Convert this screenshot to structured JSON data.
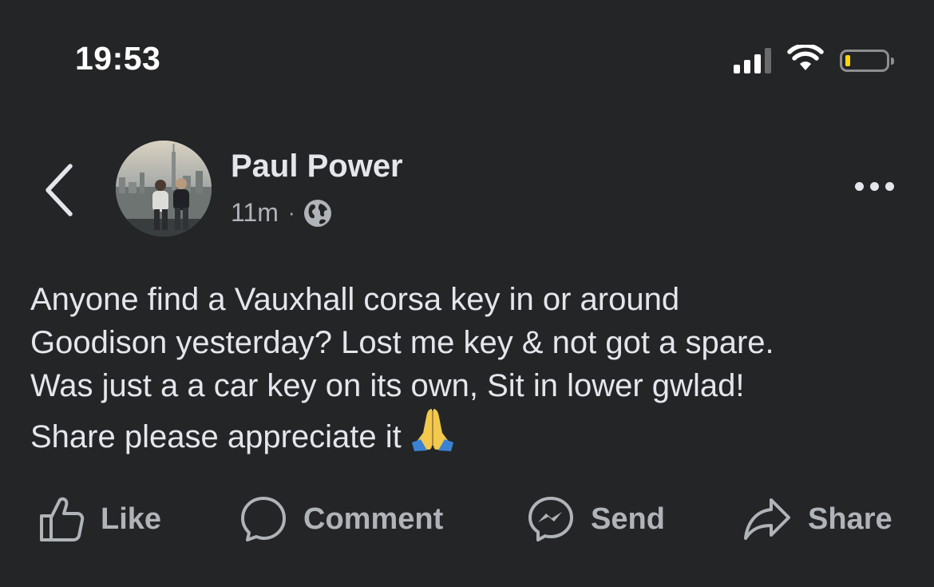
{
  "status_bar": {
    "time": "19:53"
  },
  "post": {
    "author": "Paul Power",
    "time_ago": "11m",
    "separator": "·",
    "text": "Anyone find a Vauxhall corsa key in or around\nGoodison yesterday? Lost me key & not got a spare.\nWas just a a car key on its own, Sit in lower gwlad!\nShare please appreciate it",
    "emoji": "folded-hands"
  },
  "actions": {
    "like": "Like",
    "comment": "Comment",
    "send": "Send",
    "share": "Share"
  },
  "icons": {
    "back": "back-chevron-icon",
    "audience": "globe-icon",
    "more": "more-icon"
  },
  "colors": {
    "background": "#242526",
    "primary_text": "#e4e6eb",
    "secondary_text": "#b0b3b8",
    "battery_level": "#ffd60a"
  }
}
